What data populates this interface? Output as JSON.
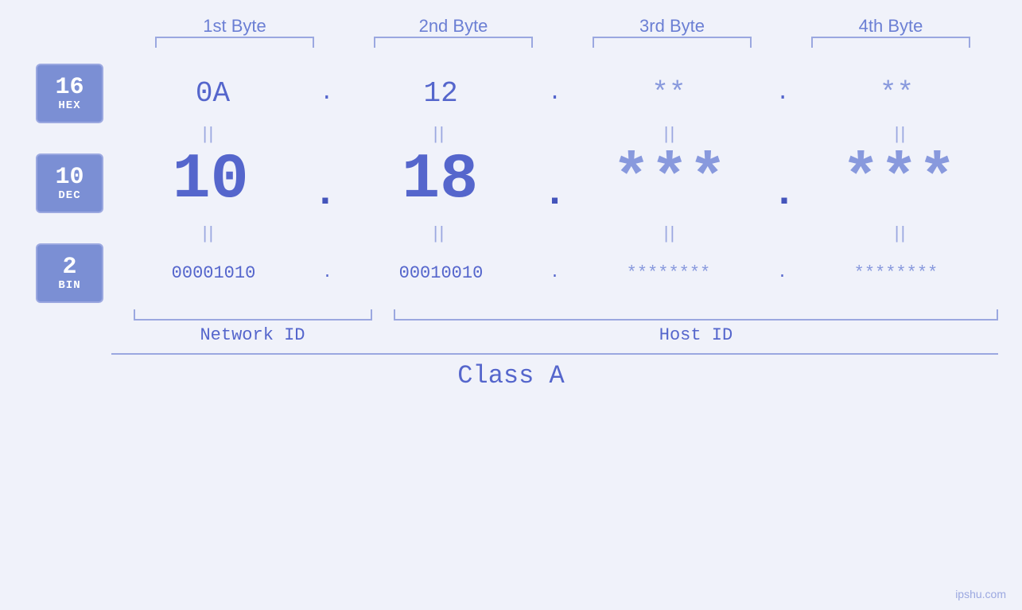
{
  "byteHeaders": {
    "b1": "1st Byte",
    "b2": "2nd Byte",
    "b3": "3rd Byte",
    "b4": "4th Byte"
  },
  "badges": {
    "hex": {
      "num": "16",
      "label": "HEX"
    },
    "dec": {
      "num": "10",
      "label": "DEC"
    },
    "bin": {
      "num": "2",
      "label": "BIN"
    }
  },
  "hexRow": {
    "b1": "0A",
    "b2": "12",
    "b3": "**",
    "b4": "**",
    "dots": "."
  },
  "decRow": {
    "b1": "10",
    "b2": "18",
    "b3": "***",
    "b4": "***",
    "dots": "."
  },
  "binRow": {
    "b1": "00001010",
    "b2": "00010010",
    "b3": "********",
    "b4": "********",
    "dots": "."
  },
  "labels": {
    "networkId": "Network ID",
    "hostId": "Host ID",
    "classA": "Class A"
  },
  "watermark": "ipshu.com",
  "equals": "||"
}
